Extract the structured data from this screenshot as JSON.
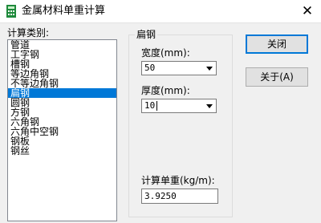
{
  "window": {
    "title": "金属材料单重计算",
    "close_glyph": "✕",
    "icon": "calculator-icon"
  },
  "category": {
    "label": "计算类别:",
    "items": [
      "管道",
      "工字钢",
      "槽钢",
      "等边角钢",
      "不等边角钢",
      "扁钢",
      "圆钢",
      "方钢",
      "六角钢",
      "六角中空钢",
      "钢板",
      "钢丝"
    ],
    "selected_index": 5
  },
  "group": {
    "title": "扁钢",
    "width": {
      "label": "宽度(mm):",
      "value": "50"
    },
    "thickness": {
      "label": "厚度(mm):",
      "value": "10"
    },
    "unit_weight": {
      "label": "计算单重(kg/m):",
      "value": "3.9250"
    }
  },
  "buttons": {
    "close": "关闭",
    "about": "关于(A)"
  },
  "colors": {
    "selection": "#0078d7",
    "dialog_bg": "#f0f0f0",
    "icon_green": "#1f8a3c"
  }
}
